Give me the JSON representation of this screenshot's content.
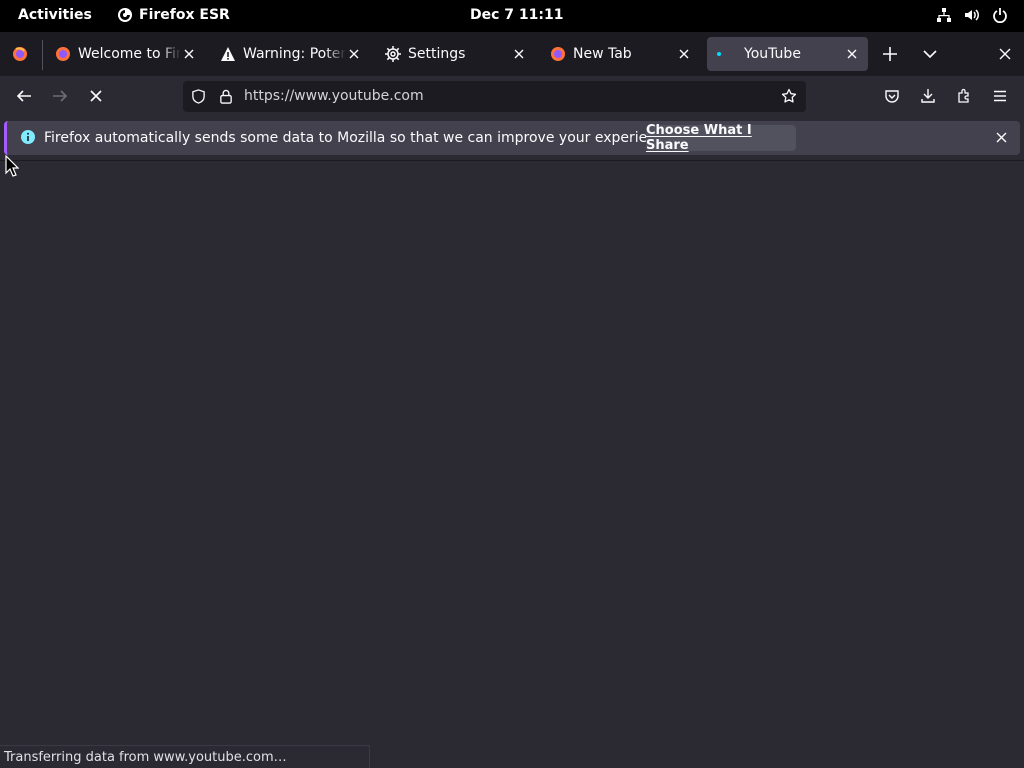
{
  "topbar": {
    "activities": "Activities",
    "app_name": "Firefox ESR",
    "clock": "Dec 7  11:11"
  },
  "tabs": [
    {
      "label": "Welcome to Firefox",
      "icon": "firefox-icon"
    },
    {
      "label": "Warning: Potential Security Risk Ahead",
      "icon": "warning-icon"
    },
    {
      "label": "Settings",
      "icon": "gear-icon"
    },
    {
      "label": "New Tab",
      "icon": "firefox-icon"
    },
    {
      "label": "YouTube",
      "icon": "loading-dot-icon",
      "active": true
    }
  ],
  "navbar": {
    "url": "https://www.youtube.com"
  },
  "notification": {
    "message": "Firefox automatically sends some data to Mozilla so that we can improve your experience.",
    "button_label": "Choose What I Share"
  },
  "status": {
    "text": "Transferring data from www.youtube.com…"
  },
  "colors": {
    "chrome_dark": "#1c1b22",
    "toolbar": "#2b2a33",
    "active_tab": "#42414d",
    "accent": "#a45cff"
  }
}
